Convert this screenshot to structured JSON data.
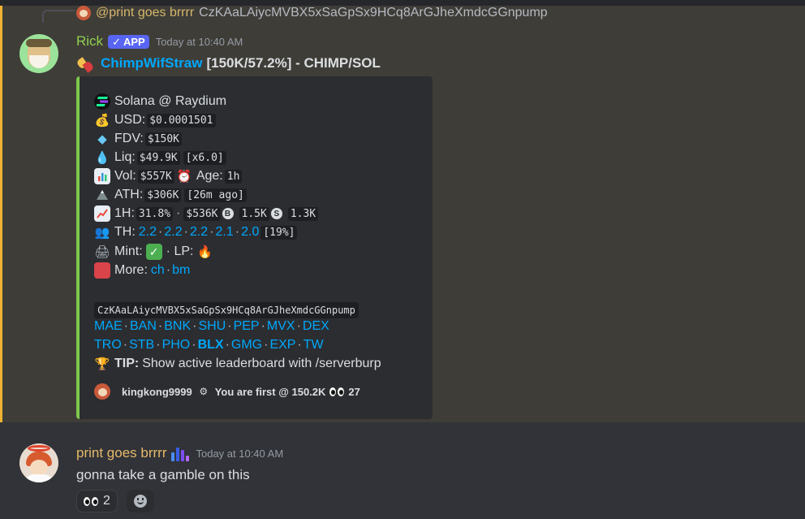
{
  "reply": {
    "user": "@print goes brrrr",
    "text": "CzKAaLAiycMVBX5xSaGpSx9HCq8ArGJheXmdcGGnpump"
  },
  "message1": {
    "username": "Rick",
    "badge": "APP",
    "badge_check": "✓",
    "timestamp": "Today at 10:40 AM",
    "title_link": "ChimpWifStraw",
    "title_rest": "[150K/57.2%] - CHIMP/SOL",
    "embed": {
      "chain_line": "Solana @ Raydium",
      "usd_label": "USD:",
      "usd_value": "$0.0001501",
      "fdv_label": "FDV:",
      "fdv_value": "$150K",
      "liq_label": "Liq:",
      "liq_value": "$49.9K",
      "liq_mult": "[x6.0]",
      "vol_label": "Vol:",
      "vol_value": "$557K",
      "age_label": "Age:",
      "age_value": "1h",
      "ath_label": "ATH:",
      "ath_value": "$306K",
      "ath_ago": "[26m ago]",
      "h1_label": "1H:",
      "h1_pct": "31.8%",
      "h1_dot": "·",
      "h1_vol": "$536K",
      "h1_buys": "1.5K",
      "h1_sells": "1.3K",
      "th_label": "TH:",
      "th_values": [
        "2.2",
        "2.2",
        "2.2",
        "2.1",
        "2.0"
      ],
      "th_total": "[19%]",
      "mint_label": "Mint:",
      "lp_label": "· LP:",
      "more_label": "More:",
      "more_links": [
        "ch",
        "bm"
      ],
      "contract": "CzKAaLAiycMVBX5xSaGpSx9HCq8ArGJheXmdcGGnpump",
      "links_row1": [
        "MAE",
        "BAN",
        "BNK",
        "SHU",
        "PEP",
        "MVX",
        "DEX"
      ],
      "links_row2": [
        "TRO",
        "STB",
        "PHO",
        "BLX",
        "GMG",
        "EXP",
        "TW"
      ],
      "tip_label": "TIP:",
      "tip_text": "Show active leaderboard with /serverburp",
      "footer_user": "kingkong9999",
      "footer_text": "You are first @ 150.2K",
      "footer_count": "27"
    }
  },
  "message2": {
    "username": "print goes brrrr",
    "timestamp": "Today at 10:40 AM",
    "text": "gonna take a gamble on this",
    "reaction_count": "2"
  },
  "colors": {
    "highlight_bar": "#f0b232",
    "embed_border": "#7ec84d",
    "link": "#00a8fc",
    "app_badge": "#5865f2"
  }
}
